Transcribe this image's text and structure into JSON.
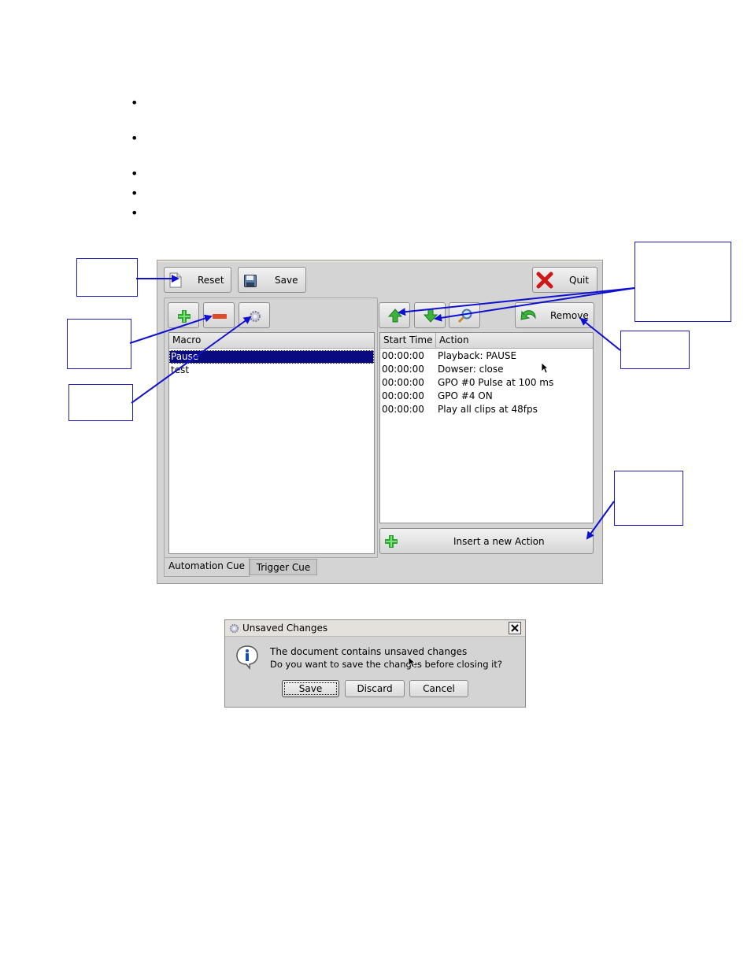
{
  "main_window": {
    "toolbar": {
      "reset_label": "Reset",
      "save_label": "Save",
      "quit_label": "Quit"
    },
    "macro_list": {
      "header": "Macro",
      "items": [
        "Pause",
        "test"
      ],
      "selected": "Pause"
    },
    "action_table": {
      "headers": [
        "Start Time",
        "Action"
      ],
      "rows": [
        {
          "start_time": "00:00:00",
          "action": "Playback: PAUSE"
        },
        {
          "start_time": "00:00:00",
          "action": "Dowser: close"
        },
        {
          "start_time": "00:00:00",
          "action": "GPO #0 Pulse at 100 ms"
        },
        {
          "start_time": "00:00:00",
          "action": "GPO #4 ON"
        },
        {
          "start_time": "00:00:00",
          "action": "Play all clips at 48fps"
        }
      ]
    },
    "remove_label": "Remove",
    "insert_action_label": "Insert a new Action",
    "tabs": [
      {
        "label": "Automation Cue",
        "active": true
      },
      {
        "label": "Trigger Cue",
        "active": false
      }
    ]
  },
  "dialog": {
    "title": "Unsaved Changes",
    "message_line1": "The document contains unsaved changes",
    "message_line2": "Do you want to save the changes before closing it?",
    "buttons": {
      "save": "Save",
      "discard": "Discard",
      "cancel": "Cancel"
    }
  },
  "colors": {
    "selection": "#0a0a80",
    "annotation": "#1010d0",
    "window_bg": "#d4d4d4"
  },
  "icons": [
    "new-document-icon",
    "floppy-disk-icon",
    "red-x-icon",
    "plus-icon",
    "minus-icon",
    "gear-icon",
    "up-arrow-icon",
    "down-arrow-icon",
    "magnifier-icon",
    "undo-arrow-icon",
    "info-icon",
    "close-icon"
  ]
}
